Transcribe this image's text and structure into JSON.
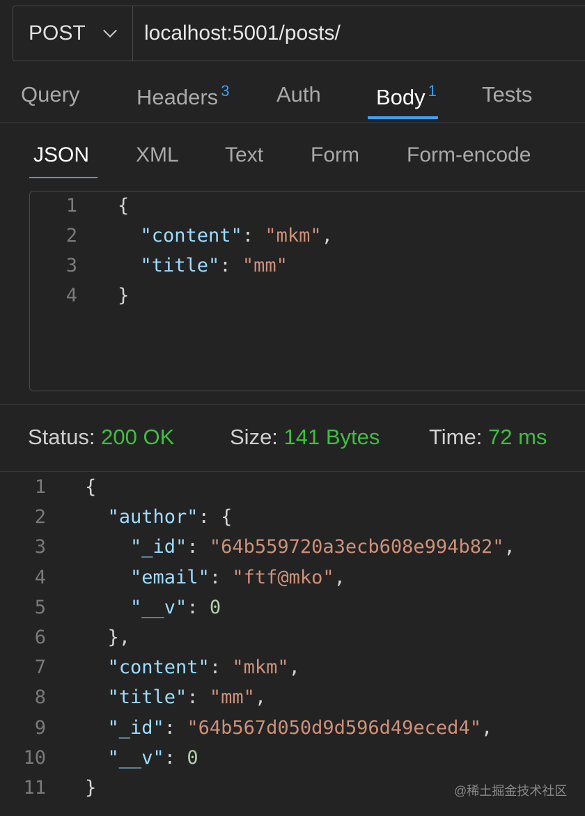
{
  "request": {
    "method": "POST",
    "url": "localhost:5001/posts/"
  },
  "tabs": [
    {
      "label": "Query",
      "badge": ""
    },
    {
      "label": "Headers",
      "badge": "3"
    },
    {
      "label": "Auth",
      "badge": ""
    },
    {
      "label": "Body",
      "badge": "1"
    },
    {
      "label": "Tests",
      "badge": ""
    }
  ],
  "active_tab": "Body",
  "body_types": [
    "JSON",
    "XML",
    "Text",
    "Form",
    "Form-encode"
  ],
  "active_body_type": "JSON",
  "request_body": [
    {
      "n": "1",
      "tokens": [
        [
          "p",
          "{"
        ]
      ]
    },
    {
      "n": "2",
      "tokens": [
        [
          "p",
          "  "
        ],
        [
          "k",
          "\"content\""
        ],
        [
          "p",
          ": "
        ],
        [
          "s",
          "\"mkm\""
        ],
        [
          "p",
          ","
        ]
      ]
    },
    {
      "n": "3",
      "tokens": [
        [
          "p",
          "  "
        ],
        [
          "k",
          "\"title\""
        ],
        [
          "p",
          ": "
        ],
        [
          "s",
          "\"mm\""
        ]
      ]
    },
    {
      "n": "4",
      "tokens": [
        [
          "p",
          "}"
        ]
      ]
    }
  ],
  "status": {
    "status_label": "Status:",
    "status_value": "200 OK",
    "size_label": "Size:",
    "size_value": "141 Bytes",
    "time_label": "Time:",
    "time_value": "72 ms"
  },
  "response_body": [
    {
      "n": "1",
      "tokens": [
        [
          "p",
          "{"
        ]
      ]
    },
    {
      "n": "2",
      "tokens": [
        [
          "p",
          "  "
        ],
        [
          "k",
          "\"author\""
        ],
        [
          "p",
          ": {"
        ]
      ]
    },
    {
      "n": "3",
      "tokens": [
        [
          "p",
          "    "
        ],
        [
          "k",
          "\"_id\""
        ],
        [
          "p",
          ": "
        ],
        [
          "s",
          "\"64b559720a3ecb608e994b82\""
        ],
        [
          "p",
          ","
        ]
      ]
    },
    {
      "n": "4",
      "tokens": [
        [
          "p",
          "    "
        ],
        [
          "k",
          "\"email\""
        ],
        [
          "p",
          ": "
        ],
        [
          "s",
          "\"ftf@mko\""
        ],
        [
          "p",
          ","
        ]
      ]
    },
    {
      "n": "5",
      "tokens": [
        [
          "p",
          "    "
        ],
        [
          "k",
          "\"__v\""
        ],
        [
          "p",
          ": "
        ],
        [
          "n",
          "0"
        ]
      ]
    },
    {
      "n": "6",
      "tokens": [
        [
          "p",
          "  },"
        ]
      ]
    },
    {
      "n": "7",
      "tokens": [
        [
          "p",
          "  "
        ],
        [
          "k",
          "\"content\""
        ],
        [
          "p",
          ": "
        ],
        [
          "s",
          "\"mkm\""
        ],
        [
          "p",
          ","
        ]
      ]
    },
    {
      "n": "8",
      "tokens": [
        [
          "p",
          "  "
        ],
        [
          "k",
          "\"title\""
        ],
        [
          "p",
          ": "
        ],
        [
          "s",
          "\"mm\""
        ],
        [
          "p",
          ","
        ]
      ]
    },
    {
      "n": "9",
      "tokens": [
        [
          "p",
          "  "
        ],
        [
          "k",
          "\"_id\""
        ],
        [
          "p",
          ": "
        ],
        [
          "s",
          "\"64b567d050d9d596d49eced4\""
        ],
        [
          "p",
          ","
        ]
      ]
    },
    {
      "n": "10",
      "tokens": [
        [
          "p",
          "  "
        ],
        [
          "k",
          "\"__v\""
        ],
        [
          "p",
          ": "
        ],
        [
          "n",
          "0"
        ]
      ]
    },
    {
      "n": "11",
      "tokens": [
        [
          "p",
          "}"
        ]
      ]
    }
  ],
  "watermark": "@稀土掘金技术社区"
}
